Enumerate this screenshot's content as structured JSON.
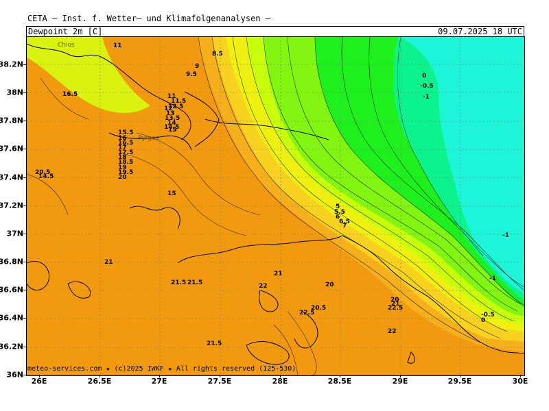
{
  "header": {
    "title": "CETA — Inst. f. Wetter— und Klimafolgenanalysen —",
    "variable": "Dewpoint 2m [C]",
    "datetime": "09.07.2025 18 UTC"
  },
  "axes": {
    "lat_labels": [
      "38.2N",
      "38N",
      "37.8N",
      "37.6N",
      "37.4N",
      "37.2N",
      "37N",
      "36.8N",
      "36.6N",
      "36.4N",
      "36.2N",
      "36N"
    ],
    "lon_labels": [
      "26E",
      "26.5E",
      "27E",
      "27.5E",
      "28E",
      "28.5E",
      "29E",
      "29.5E",
      "30E"
    ]
  },
  "place_labels": [
    "Chios",
    "Pyrgos"
  ],
  "contour_labels": [
    "11",
    "8.5",
    "9",
    "9.5",
    "16.5",
    "11",
    "11.5",
    "12",
    "12.5",
    "13",
    "13.5",
    "14",
    "14.5",
    "15",
    "15.5",
    "16",
    "16.5",
    "17",
    "17.5",
    "18",
    "18.5",
    "19",
    "19.5",
    "20",
    "20.5",
    "14.5",
    "15",
    "21",
    "21.5",
    "21.5",
    "22",
    "22.5",
    "20.5",
    "21",
    "20",
    "21.5",
    "22",
    "0",
    "-0.5",
    "-1",
    "-1",
    "-1",
    "-0.5",
    "0",
    "5",
    "5.5",
    "6",
    "6.5",
    "7",
    "22.5",
    "20",
    "21"
  ],
  "credit": "meteo-services.com ★ (c)2025 IWKF ★ All rights reserved (125-530)",
  "colors": {
    "orange": "#f29a0f",
    "orange_light": "#f5b01c",
    "yellow_orange": "#f7d21e",
    "yellow": "#eef00f",
    "yellow_green": "#c8ff0a",
    "green_light": "#82f511",
    "green": "#1ef01e",
    "green_cyan": "#0cf28c",
    "cyan": "#1ef5d8",
    "background": "#ffffff"
  }
}
